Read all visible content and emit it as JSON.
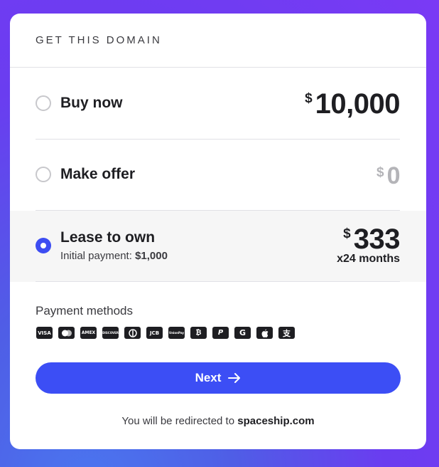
{
  "header": {
    "title": "GET THIS DOMAIN"
  },
  "options": {
    "buy": {
      "label": "Buy now",
      "currency": "$",
      "amount": "10,000",
      "selected": false
    },
    "offer": {
      "label": "Make offer",
      "currency": "$",
      "amount": "0",
      "selected": false
    },
    "lease": {
      "label": "Lease to own",
      "initial_label": "Initial payment:",
      "initial_value": "$1,000",
      "currency": "$",
      "amount": "333",
      "months": "x24 months",
      "selected": true
    }
  },
  "payment": {
    "title": "Payment methods",
    "methods": [
      "VISA",
      "mastercard",
      "AMEX",
      "DISCOVER",
      "diners",
      "JCB",
      "UnionPay",
      "bitcoin",
      "paypal",
      "google-pay",
      "apple-pay",
      "alipay"
    ]
  },
  "next_button": {
    "label": "Next"
  },
  "redirect": {
    "prefix": "You will be redirected to",
    "site": "spaceship.com"
  },
  "colors": {
    "accent": "#3c4ef5",
    "muted": "#b4b4b8",
    "text": "#1e1e22"
  }
}
